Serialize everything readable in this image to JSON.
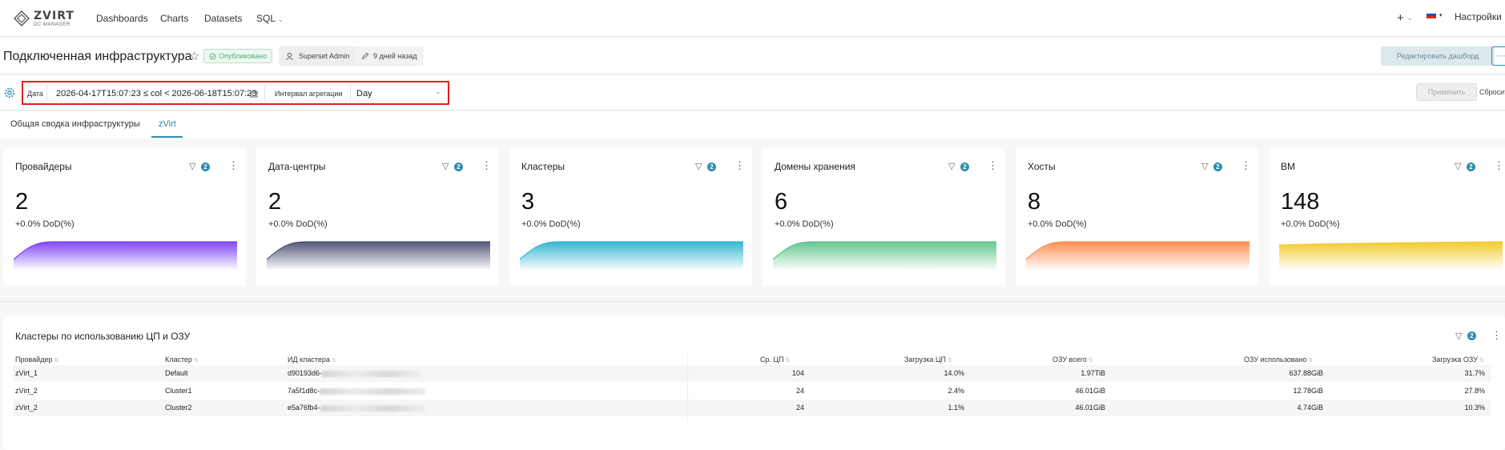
{
  "nav": {
    "logo_title": "ZVIRT",
    "logo_subtitle": "DC MANAGER",
    "links": [
      "Dashboards",
      "Charts",
      "Datasets",
      "SQL"
    ],
    "plus": "+",
    "settings": "Настройки"
  },
  "header": {
    "title": "Подключенная инфраструктура",
    "published": "Опубликовано",
    "owner": "Superset Admin",
    "modified": "9 дней назад",
    "edit": "Редактировать дашборд",
    "more": "···"
  },
  "filters": {
    "date_label": "Дата",
    "date_value": "2026-04-17T15:07:23 ≤ col < 2026-06-18T15:07:23",
    "agg_label": "Интервал агрегации",
    "agg_value": "Day",
    "apply": "Применить",
    "reset": "Сбросить"
  },
  "tabs": [
    "Общая сводка инфраструктуры",
    "zVirt"
  ],
  "active_tab": "zVirt",
  "cards": [
    {
      "title": "Провайдеры",
      "badge": "2",
      "value": "2",
      "sub": "+0.0% DoD(%)",
      "color": "#7b3ff2"
    },
    {
      "title": "Дата-центры",
      "badge": "2",
      "value": "2",
      "sub": "+0.0% DoD(%)",
      "color": "#4a4f73"
    },
    {
      "title": "Кластеры",
      "badge": "2",
      "value": "3",
      "sub": "+0.0% DoD(%)",
      "color": "#2bb4cf"
    },
    {
      "title": "Домены хранения",
      "badge": "2",
      "value": "6",
      "sub": "+0.0% DoD(%)",
      "color": "#5cc48a"
    },
    {
      "title": "Хосты",
      "badge": "2",
      "value": "8",
      "sub": "+0.0% DoD(%)",
      "color": "#ff8a4c"
    },
    {
      "title": "ВМ",
      "badge": "2",
      "value": "148",
      "sub": "+0.0% DoD(%)",
      "color": "#f2c823"
    }
  ],
  "table": {
    "title": "Кластеры по использованию ЦП и ОЗУ",
    "badge": "2",
    "columns": [
      "Провайдер",
      "Кластер",
      "ИД кластера",
      "Ср. ЦП",
      "Загрузка ЦП",
      "ОЗУ всего",
      "ОЗУ использовано",
      "Загрузка ОЗУ"
    ],
    "rows": [
      {
        "provider": "zVirt_1",
        "cluster": "Default",
        "id": "d90193d6-",
        "cpu": "104",
        "cpu_load": "14.0%",
        "ram_total": "1.97TiB",
        "ram_used": "637.88GiB",
        "ram_load": "31.7%"
      },
      {
        "provider": "zVirt_2",
        "cluster": "Cluster1",
        "id": "7a5f1d8c-",
        "cpu": "24",
        "cpu_load": "2.4%",
        "ram_total": "46.01GiB",
        "ram_used": "12.78GiB",
        "ram_load": "27.8%"
      },
      {
        "provider": "zVirt_2",
        "cluster": "Cluster2",
        "id": "e5a76fb4-",
        "cpu": "24",
        "cpu_load": "1.1%",
        "ram_total": "46.01GiB",
        "ram_used": "4.74GiB",
        "ram_load": "10.3%"
      }
    ]
  }
}
